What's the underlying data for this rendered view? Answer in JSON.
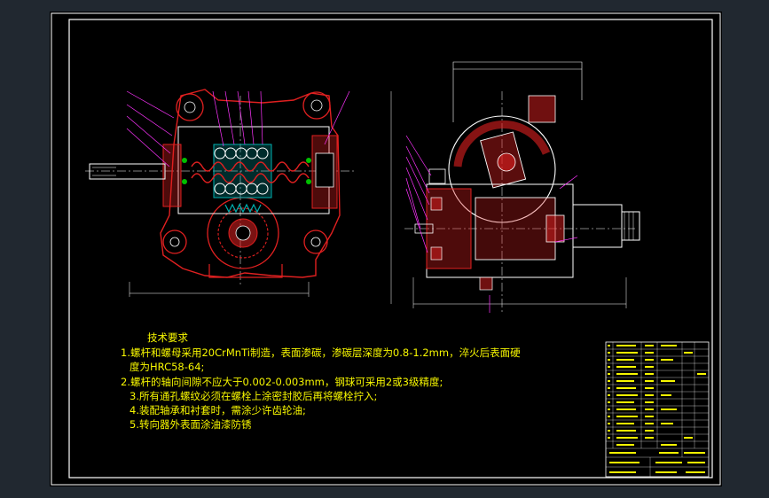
{
  "colors": {
    "background": "#212830",
    "sheet": "#000000",
    "frame": "#ffffff",
    "outline": "#ffffff",
    "section_red": "#e02020",
    "hatch": "#e02020",
    "centerline": "#ffffff",
    "leader": "#ff33ff",
    "balls": "#ffffff",
    "green_dots": "#00c000",
    "cyan_teeth": "#00b0b0",
    "text": "#f7f700"
  },
  "icons": {
    "left_view": "steering-gear-longitudinal-section",
    "right_view": "steering-gear-cross-section"
  },
  "notes": {
    "title": "技术要求",
    "items": [
      "1.螺杆和螺母采用20CrMnTi制造，表面渗碳，渗碳层深度为0.8-1.2mm，淬火后表面硬",
      "度为HRC58-64;",
      "2.螺杆的轴向间隙不应大于0.002-0.003mm，钢球可采用2或3级精度;",
      "3.所有通孔螺纹必须在螺栓上涂密封胶后再将螺栓拧入;",
      "4.装配轴承和衬套时，需涂少许齿轮油;",
      "5.转向器外表面涂油漆防锈"
    ]
  }
}
